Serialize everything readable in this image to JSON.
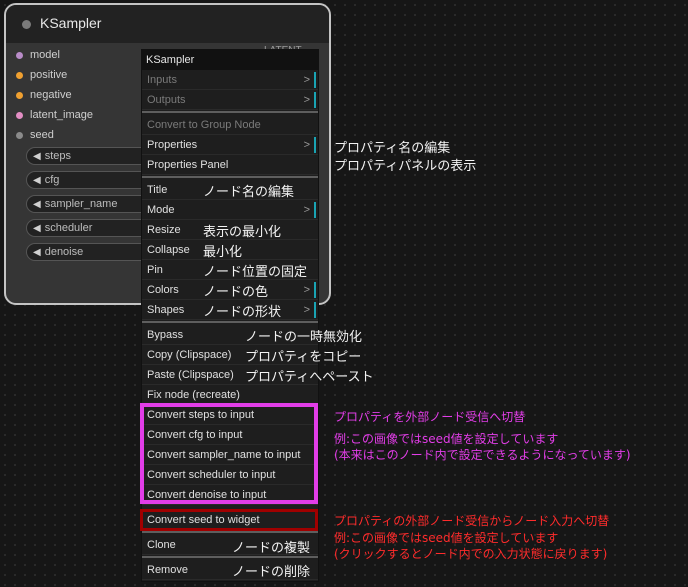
{
  "node": {
    "title": "KSampler",
    "inputs": [
      {
        "label": "model",
        "color": "#b98cc8"
      },
      {
        "label": "positive",
        "color": "#f0a030"
      },
      {
        "label": "negative",
        "color": "#f0a030"
      },
      {
        "label": "latent_image",
        "color": "#e38ec4"
      },
      {
        "label": "seed",
        "color": "#8a8a8a"
      }
    ],
    "output_label": "LATENT",
    "widgets": [
      "steps",
      "cfg",
      "sampler_name",
      "scheduler",
      "denoise"
    ]
  },
  "menu": {
    "title": "KSampler",
    "items": [
      {
        "label": "Inputs",
        "disabled": true,
        "submenu": true
      },
      {
        "label": "Outputs",
        "disabled": true,
        "submenu": true
      },
      {
        "label": "Convert to Group Node",
        "disabled": true
      },
      {
        "label": "Properties",
        "submenu": true
      },
      {
        "label": "Properties Panel"
      },
      {
        "label": "Title"
      },
      {
        "label": "Mode",
        "submenu": true
      },
      {
        "label": "Resize"
      },
      {
        "label": "Collapse"
      },
      {
        "label": "Pin"
      },
      {
        "label": "Colors",
        "submenu": true
      },
      {
        "label": "Shapes",
        "submenu": true
      },
      {
        "label": "Bypass"
      },
      {
        "label": "Copy (Clipspace)"
      },
      {
        "label": "Paste (Clipspace)"
      },
      {
        "label": "Fix node (recreate)"
      },
      {
        "label": "Convert steps to input"
      },
      {
        "label": "Convert cfg to input"
      },
      {
        "label": "Convert sampler_name to input"
      },
      {
        "label": "Convert scheduler to input"
      },
      {
        "label": "Convert denoise to input"
      },
      {
        "label": "Convert seed to widget"
      },
      {
        "label": "Clone"
      },
      {
        "label": "Remove"
      }
    ],
    "submenu_glyph": ">"
  },
  "annotations": {
    "properties": "プロパティ名の編集",
    "properties_panel": "プロパティパネルの表示",
    "title": "ノード名の編集",
    "resize": "表示の最小化",
    "collapse": "最小化",
    "pin": "ノード位置の固定",
    "colors": "ノードの色",
    "shapes": "ノードの形状",
    "bypass": "ノードの一時無効化",
    "copy": "プロパティをコピー",
    "paste": "プロパティへペースト",
    "convert_inputs_1": "プロパティを外部ノード受信へ切替",
    "convert_inputs_2": "例:この画像ではseed値を設定しています",
    "convert_inputs_3": "(本来はこのノード内で設定できるようになっています)",
    "convert_widget_1": "プロパティの外部ノード受信からノード入力へ切替",
    "convert_widget_2": "例:この画像ではseed値を設定しています",
    "convert_widget_3": "(クリックするとノード内での入力状態に戻ります)",
    "clone": "ノードの複製",
    "remove": "ノードの削除"
  },
  "colors": {
    "highlight_magenta": "#e23de8",
    "highlight_red": "#ff2b2b",
    "submenu_bar": "#1aa3b3"
  }
}
